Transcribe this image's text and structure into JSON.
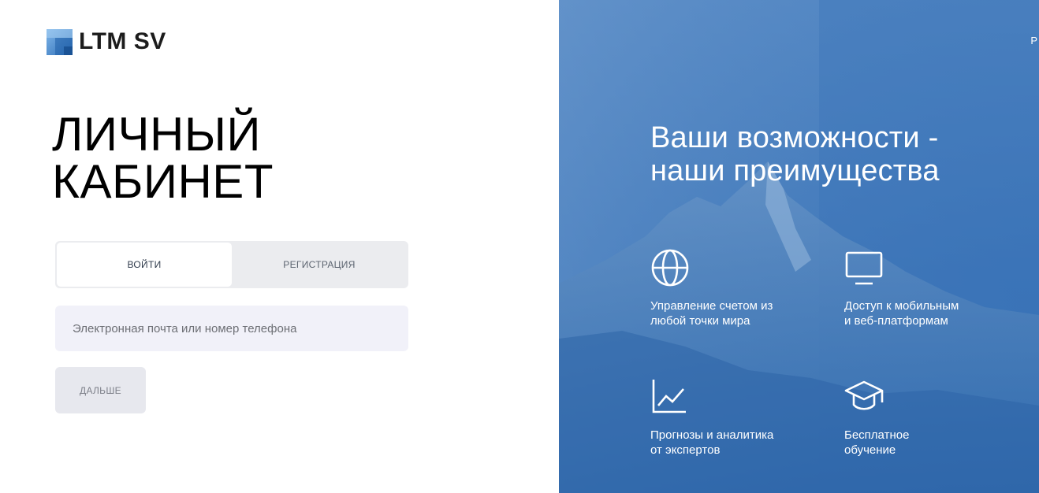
{
  "brand": {
    "name": "LTM SV",
    "accent_color": "#3a7fc4"
  },
  "login": {
    "title_line1": "ЛИЧНЫЙ",
    "title_line2": "КАБИНЕТ",
    "tabs": [
      {
        "label": "ВОЙТИ",
        "active": true
      },
      {
        "label": "РЕГИСТРАЦИЯ",
        "active": false
      }
    ],
    "email_field": {
      "value": "",
      "placeholder": "Электронная почта или номер телефона"
    },
    "next_button_label": "ДАЛЬШЕ"
  },
  "promo": {
    "language_label": "Р",
    "heading_line1": "Ваши возможности -",
    "heading_line2": "наши преимущества",
    "features": [
      {
        "icon": "globe-icon",
        "line1": "Управление счетом из",
        "line2": "любой точки мира"
      },
      {
        "icon": "monitor-icon",
        "line1": "Доступ к мобильным",
        "line2": "и веб-платформам"
      },
      {
        "icon": "chart-line-icon",
        "line1": "Прогнозы и аналитика",
        "line2": "от экспертов"
      },
      {
        "icon": "graduation-cap-icon",
        "line1": "Бесплатное",
        "line2": "обучение"
      }
    ],
    "background_color": "#3f77b9"
  }
}
